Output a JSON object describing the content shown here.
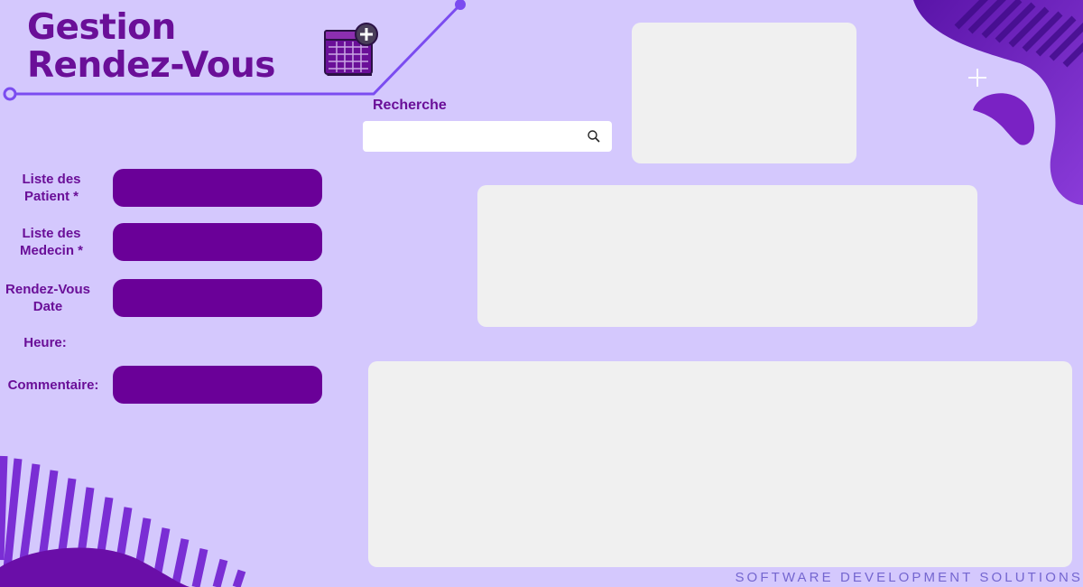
{
  "app": {
    "title_line1": "Gestion",
    "title_line2": "Rendez-Vous",
    "icon": "calendar-add-icon"
  },
  "search": {
    "label": "Recherche",
    "value": "",
    "placeholder": "",
    "icon": "search-icon"
  },
  "form": {
    "patient_label": "Liste des Patient *",
    "medecin_label": "Liste des Medecin *",
    "date_label": "Rendez-Vous Date",
    "heure_label": "Heure:",
    "commentaire_label": "Commentaire:",
    "patient_value": "",
    "medecin_value": "",
    "date_value": "",
    "commentaire_value": ""
  },
  "footer": {
    "text": "SOFTWARE DEVELOPMENT SOLUTIONS"
  },
  "colors": {
    "background": "#d4c8fd",
    "accent": "#6a0f98",
    "field": "#6a0098",
    "panel": "#f0f0f0",
    "footer_text": "#7466d0"
  }
}
